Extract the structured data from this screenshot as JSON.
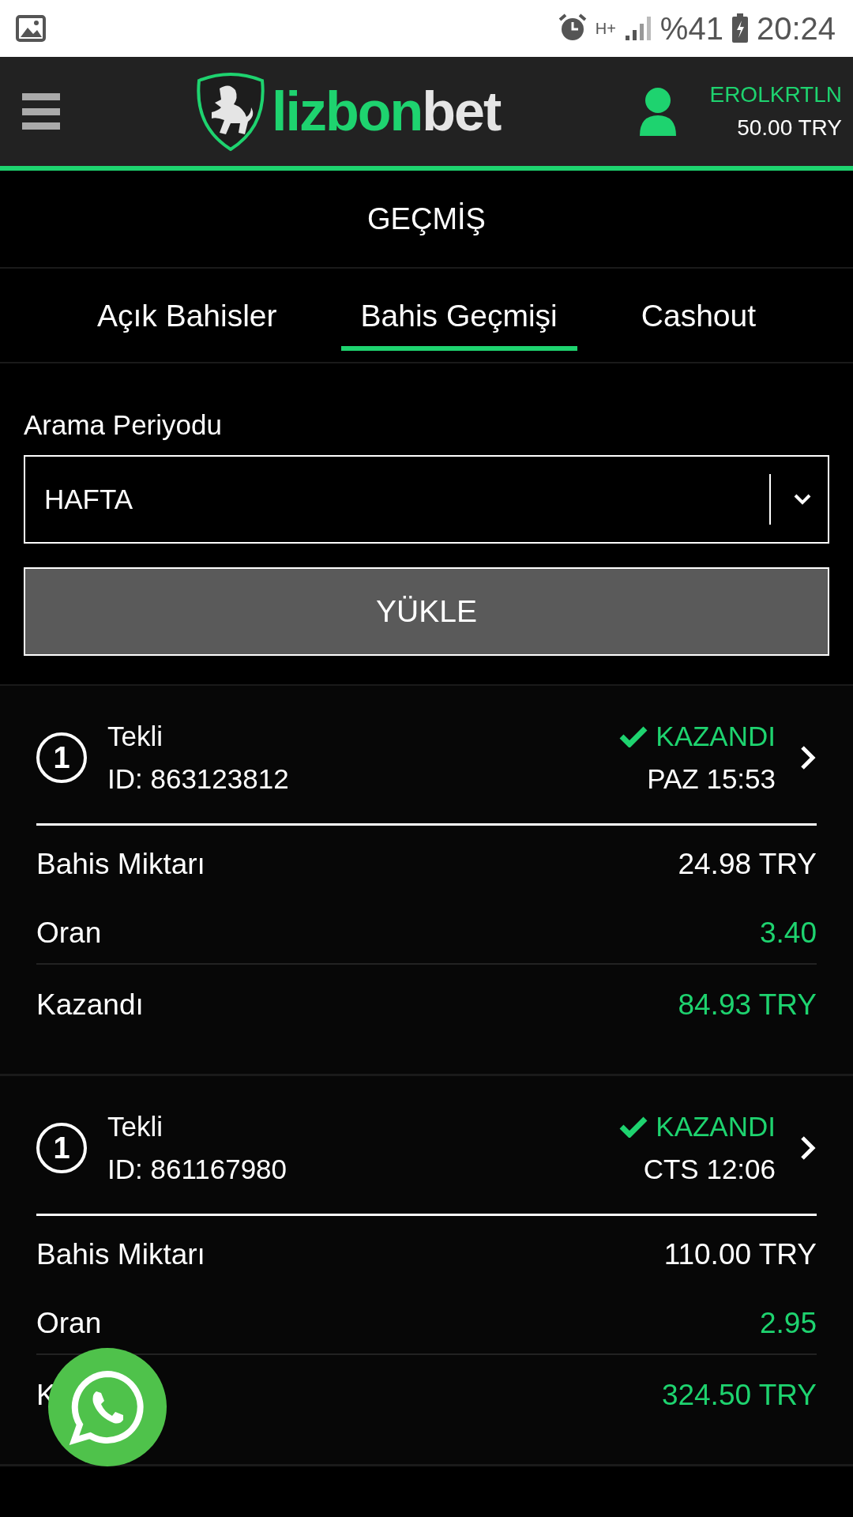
{
  "status_bar": {
    "battery": "%41",
    "time": "20:24",
    "network": "H+"
  },
  "header": {
    "logo": {
      "primary": "lizbon",
      "secondary": "bet"
    },
    "user": {
      "name": "EROLKRTLN",
      "balance": "50.00 TRY"
    }
  },
  "page_title": "GEÇMİŞ",
  "tabs": [
    {
      "label": "Açık Bahisler",
      "selected": false
    },
    {
      "label": "Bahis Geçmişi",
      "selected": true
    },
    {
      "label": "Cashout",
      "selected": false
    }
  ],
  "filter": {
    "label": "Arama Periyodu",
    "select_value": "HAFTA",
    "button": "YÜKLE"
  },
  "bets": [
    {
      "count": "1",
      "type": "Tekli",
      "id": "ID: 863123812",
      "status": "KAZANDI",
      "won": true,
      "date": "PAZ 15:53",
      "rows": [
        {
          "label": "Bahis Miktarı",
          "value": "24.98 TRY",
          "highlight": false
        },
        {
          "label": "Oran",
          "value": "3.40",
          "highlight": true
        },
        {
          "label": "Kazandı",
          "value": "84.93 TRY",
          "highlight": true
        }
      ]
    },
    {
      "count": "1",
      "type": "Tekli",
      "id": "ID: 861167980",
      "status": "KAZANDI",
      "won": true,
      "date": "CTS 12:06",
      "rows": [
        {
          "label": "Bahis Miktarı",
          "value": "110.00 TRY",
          "highlight": false
        },
        {
          "label": "Oran",
          "value": "2.95",
          "highlight": true
        },
        {
          "label": "K",
          "value": "324.50 TRY",
          "highlight": true
        }
      ]
    }
  ]
}
